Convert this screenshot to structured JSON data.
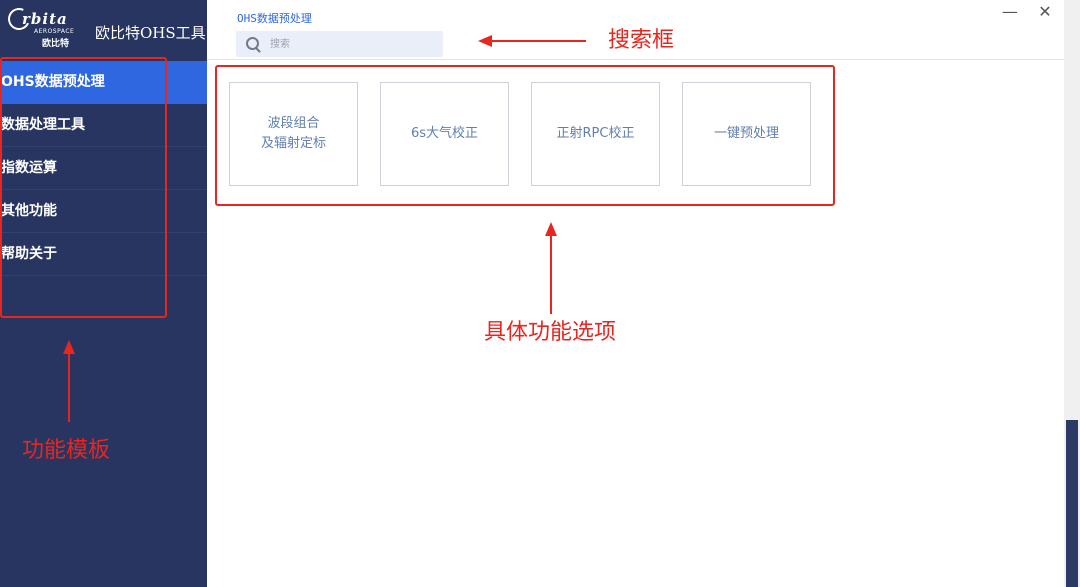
{
  "brand": {
    "logo_word": "rbita",
    "logo_sub": "AEROSPACE",
    "logo_cn": "欧比特",
    "app_title": "欧比特OHS工具"
  },
  "sidebar": {
    "items": [
      {
        "label": "OHS数据预处理",
        "active": true
      },
      {
        "label": "数据处理工具",
        "active": false
      },
      {
        "label": "指数运算",
        "active": false
      },
      {
        "label": "其他功能",
        "active": false
      },
      {
        "label": "帮助关于",
        "active": false
      }
    ]
  },
  "main": {
    "page_title": "OHS数据预处理",
    "search_placeholder": "搜索",
    "cards": [
      {
        "label": "波段组合\n及辐射定标"
      },
      {
        "label": "6s大气校正"
      },
      {
        "label": "正射RPC校正"
      },
      {
        "label": "一键预处理"
      }
    ]
  },
  "window": {
    "minimize": "—",
    "close": "✕"
  },
  "annotations": {
    "search_box": "搜索框",
    "function_options": "具体功能选项",
    "function_template": "功能模板",
    "color": "#e8261f"
  }
}
